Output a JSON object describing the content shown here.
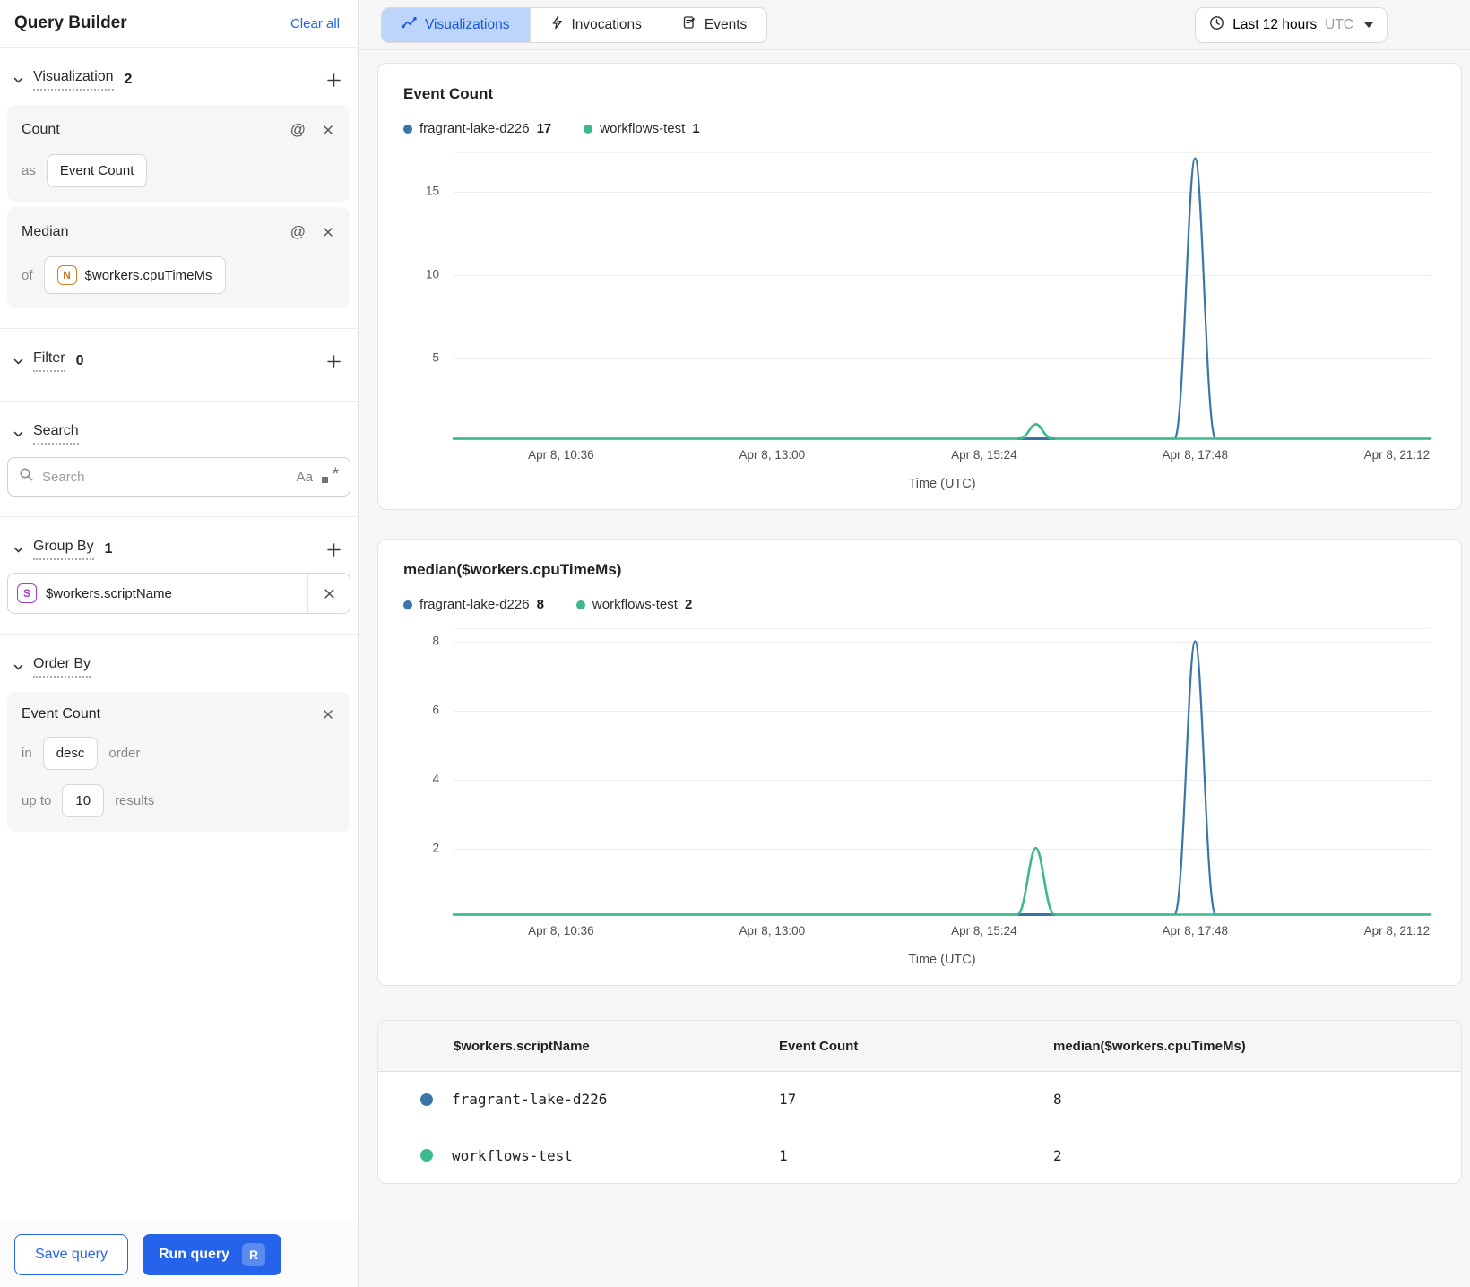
{
  "colors": {
    "accent_blue": "#2563eb",
    "tab_active_bg": "#bdd4fb",
    "tab_active_text": "#1a56db",
    "series_blue": "#3b76a8",
    "series_green": "#3cba8b",
    "series_blue_exposed": "#4a5cc5",
    "type_icon_number": "#d07d2a",
    "type_icon_string": "#a43bd0"
  },
  "sidebar": {
    "title": "Query Builder",
    "clear_all": "Clear all",
    "visualization": {
      "label": "Visualization",
      "count": "2",
      "cards": [
        {
          "title": "Count",
          "prefix": "as",
          "value": "Event Count"
        },
        {
          "title": "Median",
          "prefix": "of",
          "type_letter": "N",
          "value": "$workers.cpuTimeMs"
        }
      ]
    },
    "filter": {
      "label": "Filter",
      "count": "0"
    },
    "search": {
      "label": "Search",
      "placeholder": "Search",
      "case_label": "Aa"
    },
    "group_by": {
      "label": "Group By",
      "count": "1",
      "items": [
        {
          "type_letter": "S",
          "value": "$workers.scriptName"
        }
      ]
    },
    "order_by": {
      "label": "Order By",
      "field": "Event Count",
      "in_label": "in",
      "direction": "desc",
      "order_label": "order",
      "up_to_label": "up to",
      "limit": "10",
      "results_label": "results"
    },
    "footer": {
      "save": "Save query",
      "run": "Run query",
      "run_shortcut": "R"
    }
  },
  "topbar": {
    "tabs": [
      {
        "label": "Visualizations",
        "active": true
      },
      {
        "label": "Invocations",
        "active": false
      },
      {
        "label": "Events",
        "active": false
      }
    ],
    "time_range": {
      "label": "Last 12 hours",
      "timezone": "UTC"
    }
  },
  "chart_data": [
    {
      "type": "line",
      "title": "Event Count",
      "xlabel": "Time (UTC)",
      "legend": [
        {
          "name": "fragrant-lake-d226",
          "value": "17"
        },
        {
          "name": "workflows-test",
          "value": "1"
        }
      ],
      "x_ticks": [
        {
          "label": "Apr 8, 10:36",
          "frac": 0.11
        },
        {
          "label": "Apr 8, 13:00",
          "frac": 0.326
        },
        {
          "label": "Apr 8, 15:24",
          "frac": 0.543
        },
        {
          "label": "Apr 8, 17:48",
          "frac": 0.759
        },
        {
          "label": "Apr 8, 21:12",
          "frac": 0.9655
        }
      ],
      "y_ticks": [
        {
          "label": "5",
          "frac_top": 0.711
        },
        {
          "label": "10",
          "frac_top": 0.422
        },
        {
          "label": "15",
          "frac_top": 0.1329
        }
      ],
      "ylim": [
        0,
        17.3
      ],
      "grid": true,
      "legend_position": "top",
      "series": [
        {
          "name": "fragrant-lake-d226",
          "color_key": "series_blue",
          "baseline": 0,
          "peak": {
            "frac": 0.759,
            "value": 17,
            "half_width_frac": 0.021
          }
        },
        {
          "name": "workflows-test",
          "color_key": "series_green",
          "baseline": 0,
          "peak": {
            "frac": 0.596,
            "value": 1,
            "half_width_frac": 0.0165
          }
        }
      ],
      "exposed_baseline_segment": {
        "from_frac": 0.578,
        "to_frac": 0.615,
        "color_key": "series_blue_exposed"
      }
    },
    {
      "type": "line",
      "title": "median($workers.cpuTimeMs)",
      "xlabel": "Time (UTC)",
      "legend": [
        {
          "name": "fragrant-lake-d226",
          "value": "8"
        },
        {
          "name": "workflows-test",
          "value": "2"
        }
      ],
      "x_ticks": [
        {
          "label": "Apr 8, 10:36",
          "frac": 0.11
        },
        {
          "label": "Apr 8, 13:00",
          "frac": 0.326
        },
        {
          "label": "Apr 8, 15:24",
          "frac": 0.543
        },
        {
          "label": "Apr 8, 17:48",
          "frac": 0.759
        },
        {
          "label": "Apr 8, 21:12",
          "frac": 0.9655
        }
      ],
      "y_ticks": [
        {
          "label": "2",
          "frac_top": 0.7605
        },
        {
          "label": "4",
          "frac_top": 0.521
        },
        {
          "label": "6",
          "frac_top": 0.2814
        },
        {
          "label": "8",
          "frac_top": 0.0419
        }
      ],
      "ylim": [
        0,
        8.35
      ],
      "grid": true,
      "legend_position": "top",
      "series": [
        {
          "name": "fragrant-lake-d226",
          "color_key": "series_blue",
          "baseline": 0,
          "peak": {
            "frac": 0.759,
            "value": 8,
            "half_width_frac": 0.021
          }
        },
        {
          "name": "workflows-test",
          "color_key": "series_green",
          "baseline": 0,
          "peak": {
            "frac": 0.596,
            "value": 2,
            "half_width_frac": 0.019
          }
        }
      ],
      "exposed_baseline_segment": {
        "from_frac": 0.578,
        "to_frac": 0.615,
        "color_key": "series_blue_exposed"
      }
    }
  ],
  "table": {
    "headers": [
      "$workers.scriptName",
      "Event Count",
      "median($workers.cpuTimeMs)"
    ],
    "rows": [
      {
        "script": "fragrant-lake-d226",
        "event_count": "17",
        "median": "8"
      },
      {
        "script": "workflows-test",
        "event_count": "1",
        "median": "2"
      }
    ]
  }
}
